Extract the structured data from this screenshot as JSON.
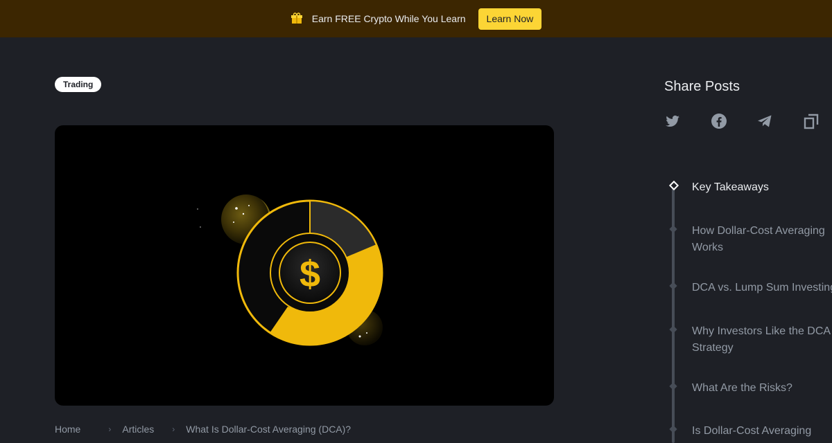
{
  "banner": {
    "icon": "gift-icon",
    "text": "Earn FREE Crypto While You Learn",
    "cta_label": "Learn Now",
    "bg_color": "#3c2601",
    "cta_color": "#fcd535"
  },
  "article": {
    "tag": "Trading",
    "hero_image": {
      "icon": "dollar-donut-chart-illustration",
      "symbol": "$",
      "accent_color": "#f0b90b"
    }
  },
  "breadcrumb": {
    "items": [
      "Home",
      "Articles",
      "What Is Dollar-Cost Averaging (DCA)?"
    ]
  },
  "share": {
    "title": "Share Posts",
    "icons": [
      "twitter-icon",
      "facebook-icon",
      "telegram-icon",
      "copy-link-icon"
    ]
  },
  "toc": {
    "items": [
      {
        "label": "Key Takeaways",
        "active": true
      },
      {
        "label": "How Dollar-Cost Averaging Works",
        "active": false
      },
      {
        "label": "DCA vs. Lump Sum Investing",
        "active": false
      },
      {
        "label": "Why Investors Like the DCA Strategy",
        "active": false
      },
      {
        "label": "What Are the Risks?",
        "active": false
      },
      {
        "label": "Is Dollar-Cost Averaging",
        "active": false
      }
    ]
  }
}
